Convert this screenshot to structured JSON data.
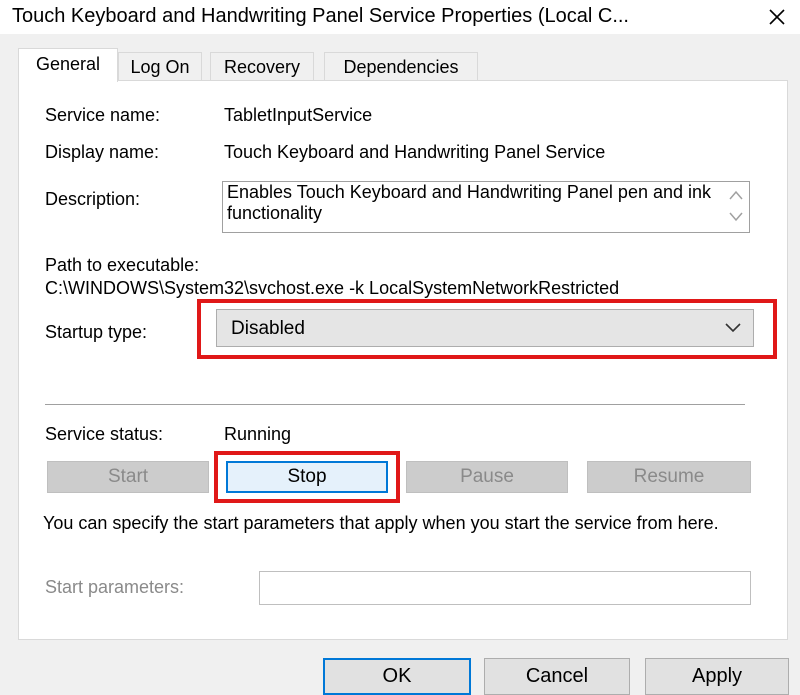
{
  "window": {
    "title": "Touch Keyboard and Handwriting Panel Service Properties (Local C..."
  },
  "tabs": [
    {
      "label": "General",
      "active": true
    },
    {
      "label": "Log On",
      "active": false
    },
    {
      "label": "Recovery",
      "active": false
    },
    {
      "label": "Dependencies",
      "active": false
    }
  ],
  "general": {
    "service_name_label": "Service name:",
    "service_name_value": "TabletInputService",
    "display_name_label": "Display name:",
    "display_name_value": "Touch Keyboard and Handwriting Panel Service",
    "description_label": "Description:",
    "description_value": "Enables Touch Keyboard and Handwriting Panel pen and ink functionality",
    "path_label": "Path to executable:",
    "path_value": "C:\\WINDOWS\\System32\\svchost.exe -k LocalSystemNetworkRestricted",
    "startup_type_label": "Startup type:",
    "startup_type_value": "Disabled",
    "service_status_label": "Service status:",
    "service_status_value": "Running",
    "buttons": {
      "start": "Start",
      "stop": "Stop",
      "pause": "Pause",
      "resume": "Resume"
    },
    "hint": "You can specify the start parameters that apply when you start the service from here.",
    "start_params_label": "Start parameters:",
    "start_params_value": ""
  },
  "footer": {
    "ok": "OK",
    "cancel": "Cancel",
    "apply": "Apply"
  },
  "colors": {
    "highlight": "#e01818",
    "focus": "#0078d7"
  },
  "icons": {
    "close": "close-icon",
    "dropdown": "chevron-down-icon",
    "scroll_up": "scroll-up-icon",
    "scroll_down": "scroll-down-icon"
  }
}
